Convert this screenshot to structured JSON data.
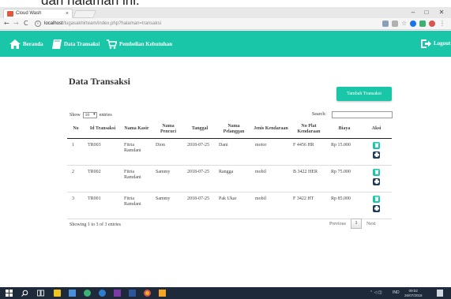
{
  "caption": {
    "text": "dan halaman ini."
  },
  "browser": {
    "tab_title": "Cloud Wash",
    "tab_close": "×",
    "url_host": "localhost",
    "url_path": "/tugasakhirteam/index.php?halaman=transaksi",
    "window_buttons": [
      "–",
      "□",
      "✕"
    ],
    "nav_back": "←",
    "nav_forward": "→",
    "nav_reload": "C"
  },
  "navbar": {
    "items": [
      {
        "label": "Beranda",
        "icon": "home-icon"
      },
      {
        "label": "Data Transaksi",
        "icon": "book-icon"
      },
      {
        "label": "Pembelian Kebutuhan",
        "icon": "cart-icon"
      }
    ],
    "logout_label": "Logout",
    "accent_color": "#19c7a8"
  },
  "page": {
    "title": "Data Transaksi",
    "add_button_label": "Tambah Transaksi"
  },
  "table_controls": {
    "show_label": "Show",
    "entries_value": "10",
    "entries_label": "entries",
    "search_label": "Search:",
    "search_value": ""
  },
  "table": {
    "columns": [
      "No",
      "Id Transaksi",
      "Nama Kasir",
      "Nama Pencuci",
      "Tanggal",
      "Nama Pelanggan",
      "Jenis Kendaraan",
      "No Plat Kendaraan",
      "Biaya",
      "Aksi"
    ],
    "rows": [
      {
        "no": "1",
        "id": "TR003",
        "kasir": "Fitria Ramdani",
        "pencuci": "Dion",
        "tanggal": "2018-07-25",
        "pelanggan": "Dani",
        "jenis": "motor",
        "plat": "F 4456 HR",
        "biaya": "Rp 15.000"
      },
      {
        "no": "2",
        "id": "TR002",
        "kasir": "Fitria Ramdani",
        "pencuci": "Sammy",
        "tanggal": "2018-07-25",
        "pelanggan": "Rangga",
        "jenis": "mobil",
        "plat": "B 3422 HER",
        "biaya": "Rp 75.000"
      },
      {
        "no": "3",
        "id": "TR001",
        "kasir": "Fitria Ramdani",
        "pencuci": "Sammy",
        "tanggal": "2018-07-25",
        "pelanggan": "Pak Ukar",
        "jenis": "mobil",
        "plat": "F 3422 HT",
        "biaya": "Rp 85.000"
      }
    ]
  },
  "footer": {
    "info": "Showing 1 to 3 of 3 entries",
    "previous_label": "Previous",
    "current_page": "1",
    "next_label": "Next"
  },
  "taskbar": {
    "time": "09:52",
    "date": "26/07/2018",
    "lang": "IND"
  }
}
